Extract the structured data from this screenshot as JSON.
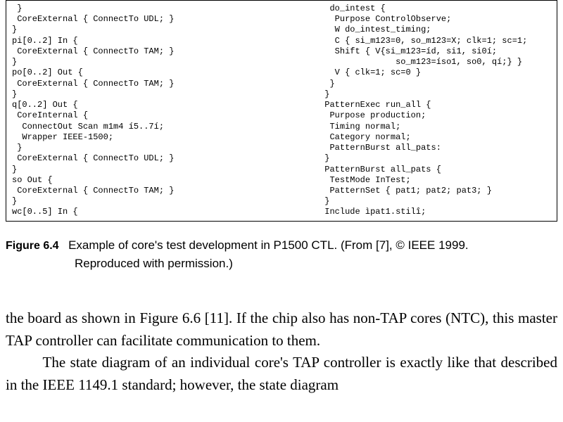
{
  "code": {
    "left": " }\n CoreExternal { ConnectTo UDL; }\n}\npi[0..2] In {\n CoreExternal { ConnectTo TAM; }\n}\npo[0..2] Out {\n CoreExternal { ConnectTo TAM; }\n}\nq[0..2] Out {\n CoreInternal {\n  ConnectOut Scan m1m4 í5..7í;\n  Wrapper IEEE-1500;\n }\n CoreExternal { ConnectTo UDL; }\n}\nso Out {\n CoreExternal { ConnectTo TAM; }\n}\nwc[0..5] In {",
    "right": " do_intest {\n  Purpose ControlObserve;\n  W do_intest_timing;\n  C { si_m123=0, so_m123=X; clk=1; sc=1;\n  Shift { V{si_m123=íd, si1, si0í;\n              so_m123=íso1, so0, qí;} }\n  V { clk=1; sc=0 }\n }\n}\nPatternExec run_all {\n Purpose production;\n Timing normal;\n Category normal;\n PatternBurst all_pats:\n}\nPatternBurst all_pats {\n TestMode InTest;\n PatternSet { pat1; pat2; pat3; }\n}\nInclude ìpat1.stilî;"
  },
  "figure": {
    "label": "Figure 6.4",
    "caption_line1": "Example of core's test development in P1500 CTL. (From [7], © IEEE 1999.",
    "caption_line2": "Reproduced with permission.)"
  },
  "body": {
    "p1": "the board as shown in Figure 6.6 [11]. If the chip also has non-TAP cores (NTC), this master TAP controller can facilitate communication to them.",
    "p2": "The state diagram of an individual core's TAP controller is exactly like that described in the IEEE 1149.1 standard; however, the state diagram"
  }
}
